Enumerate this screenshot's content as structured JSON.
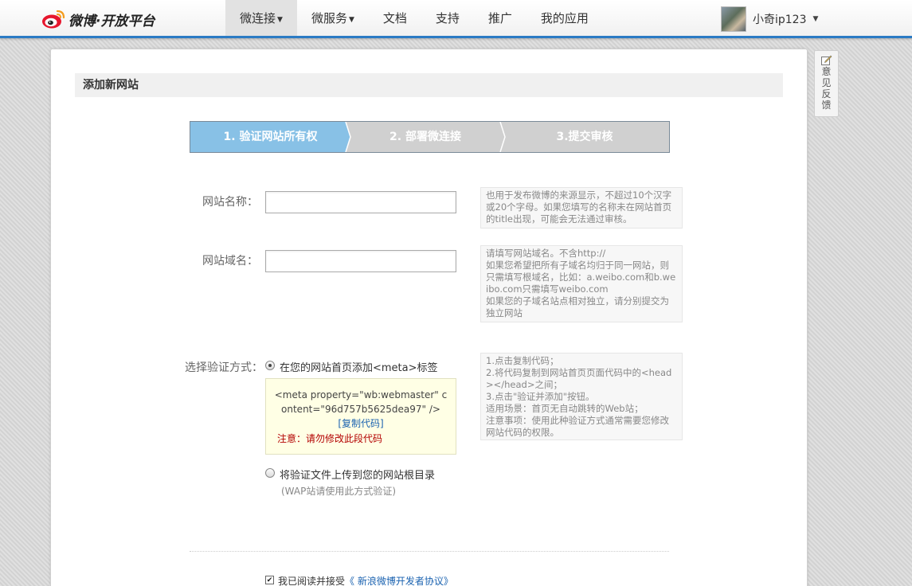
{
  "header": {
    "logo_text": "微博·开放平台",
    "nav": [
      {
        "label": "微连接",
        "dropdown": true,
        "active": true
      },
      {
        "label": "微服务",
        "dropdown": true,
        "active": false
      },
      {
        "label": "文档",
        "dropdown": false,
        "active": false
      },
      {
        "label": "支持",
        "dropdown": false,
        "active": false
      },
      {
        "label": "推广",
        "dropdown": false,
        "active": false
      },
      {
        "label": "我的应用",
        "dropdown": false,
        "active": false
      }
    ],
    "user": {
      "name": "小奇ip123"
    },
    "accent_color": "#2b7bc4"
  },
  "page": {
    "title": "添加新网站",
    "steps": [
      {
        "label": "1. 验证网站所有权",
        "active": true
      },
      {
        "label": "2. 部署微连接",
        "active": false
      },
      {
        "label": "3.提交审核",
        "active": false
      }
    ],
    "form": {
      "site_name": {
        "label": "网站名称：",
        "value": "",
        "hint": "也用于发布微博的来源显示，不超过10个汉字或20个字母。如果您填写的名称未在网站首页的title出现，可能会无法通过审核。"
      },
      "site_domain": {
        "label": "网站域名：",
        "value": "",
        "hint": "请填写网站域名。不含http://\n如果您希望把所有子域名均归于同一网站，则只需填写根域名，比如：a.weibo.com和b.weibo.com只需填写weibo.com\n如果您的子域名站点相对独立，请分别提交为独立网站"
      },
      "verify": {
        "label": "选择验证方式：",
        "option_meta": "在您的网站首页添加<meta>标签",
        "meta_code": "<meta property=\"wb:webmaster\" content=\"96d757b5625dea97\" />",
        "copy_link": "[复制代码]",
        "warning": "注意：请勿修改此段代码",
        "option_file": "将验证文件上传到您的网站根目录",
        "option_file_note": "(WAP站请使用此方式验证)",
        "selected": "meta",
        "hint": "1.点击复制代码；\n2.将代码复制到网站首页页面代码中的<head></head>之间；\n3.点击\"验证并添加\"按钮。\n适用场景：首页无自动跳转的Web站；\n注意事项：使用此种验证方式通常需要您修改网站代码的权限。"
      },
      "agreement": {
        "checked": true,
        "text": "我已阅读并接受",
        "link": "《 新浪微博开发者协议》"
      }
    }
  },
  "feedback": {
    "label": "意见反馈",
    "icon": "edit-icon"
  }
}
